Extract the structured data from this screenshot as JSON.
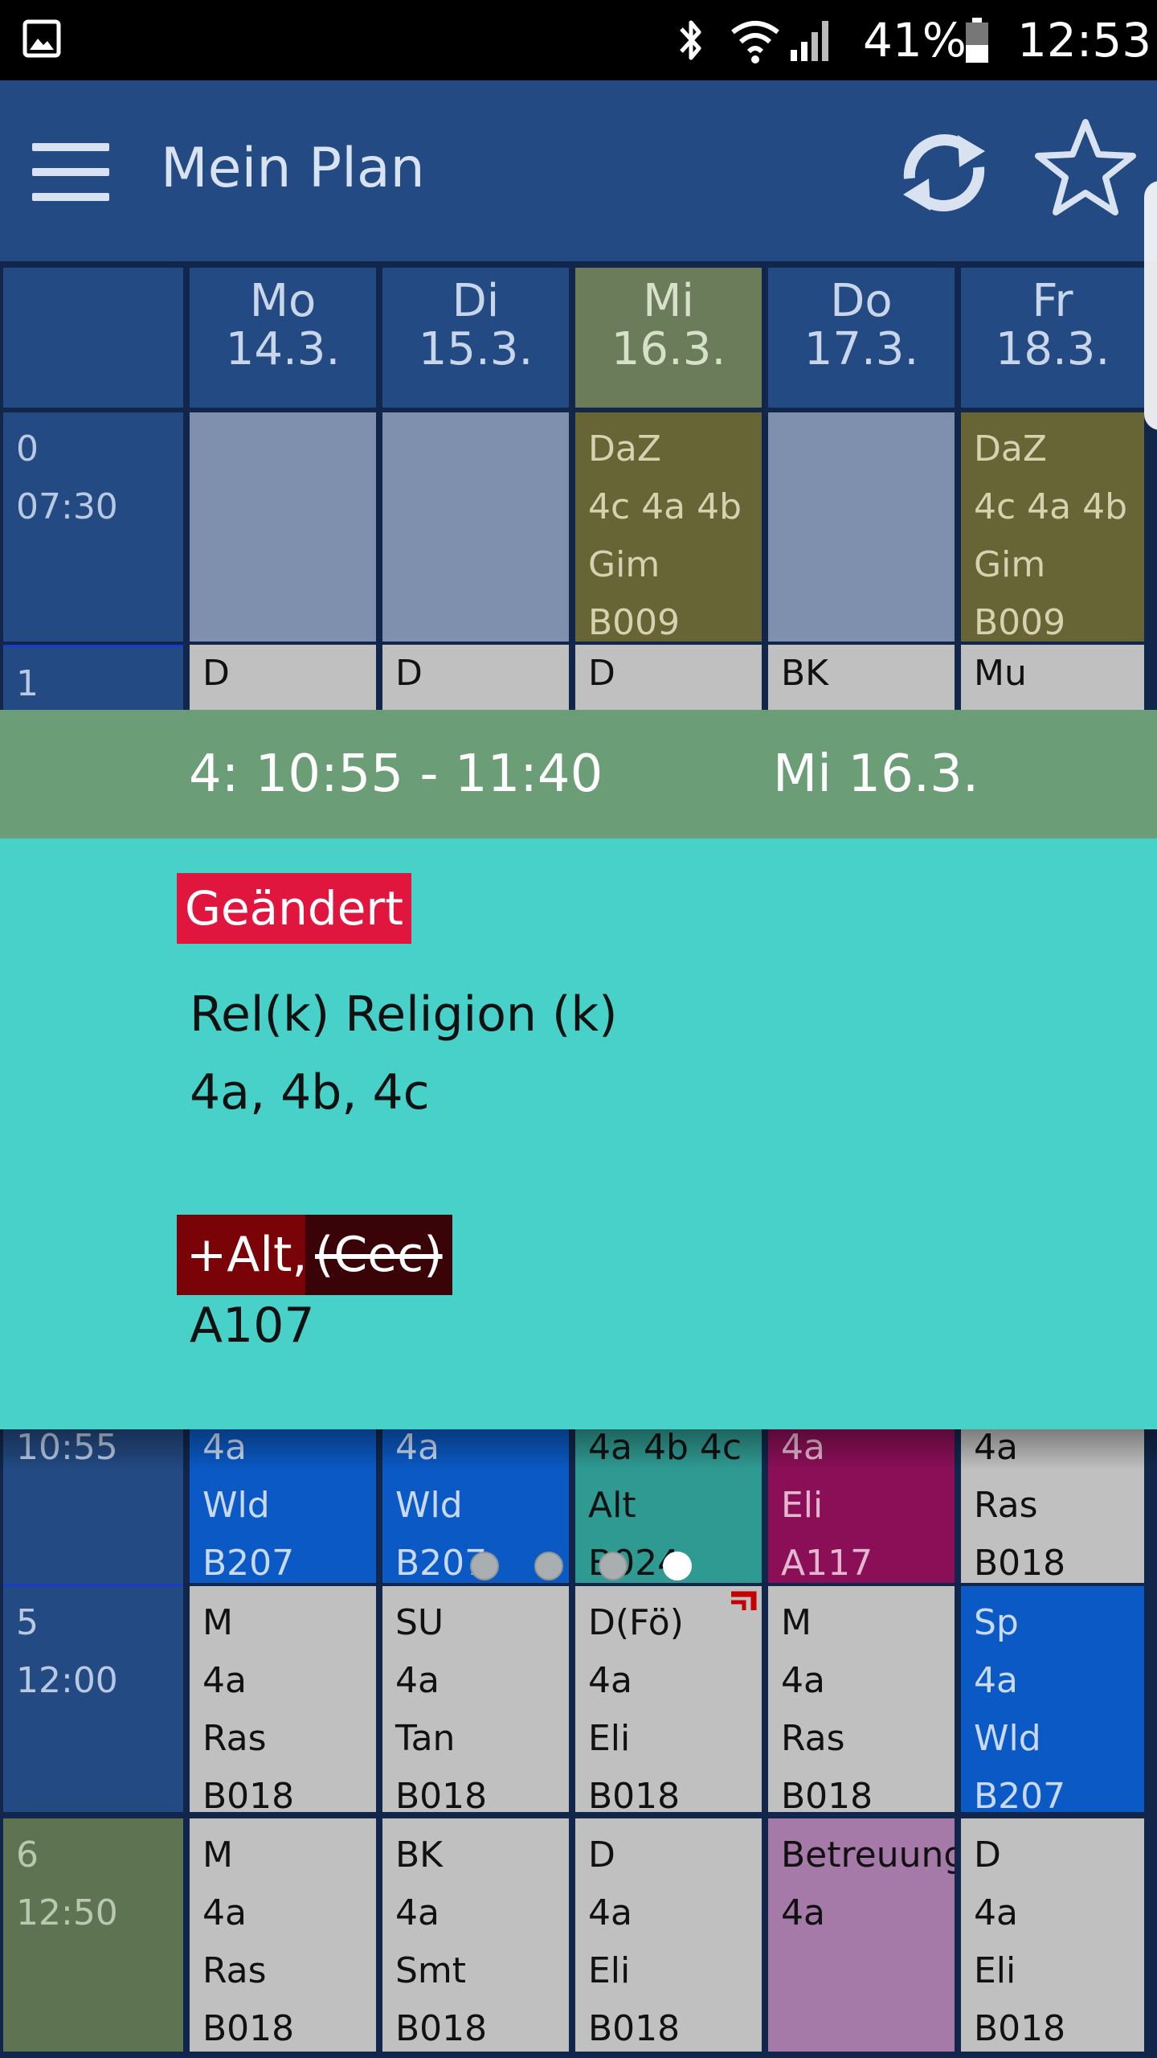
{
  "status_bar": {
    "battery": "41%",
    "time": "12:53",
    "icons": [
      "gallery-icon",
      "bluetooth-icon",
      "wifi-icon",
      "signal-icon",
      "battery-icon"
    ]
  },
  "app_bar": {
    "title": "Mein Plan",
    "icons": [
      "menu-icon",
      "refresh-icon",
      "star-icon"
    ]
  },
  "days": [
    {
      "name": "Mo",
      "date": "14.3."
    },
    {
      "name": "Di",
      "date": "15.3."
    },
    {
      "name": "Mi",
      "date": "16.3."
    },
    {
      "name": "Do",
      "date": "17.3."
    },
    {
      "name": "Fr",
      "date": "18.3."
    }
  ],
  "periods": {
    "p0": {
      "num": "0",
      "time": "07:30"
    },
    "p1": {
      "num": "1"
    },
    "p4": {
      "time": "10:55"
    },
    "p5": {
      "num": "5",
      "time": "12:00"
    },
    "p6": {
      "num": "6",
      "time": "12:50"
    }
  },
  "rows": {
    "r0": [
      {
        "lines": []
      },
      {
        "lines": []
      },
      {
        "lines": [
          "DaZ",
          "4c 4a 4b",
          "Gim",
          "B009"
        ]
      },
      {
        "lines": []
      },
      {
        "lines": [
          "DaZ",
          "4c 4a 4b",
          "Gim",
          "B009"
        ]
      }
    ],
    "r1": [
      {
        "lines": [
          "D"
        ]
      },
      {
        "lines": [
          "D"
        ]
      },
      {
        "lines": [
          "D"
        ]
      },
      {
        "lines": [
          "BK"
        ]
      },
      {
        "lines": [
          "Mu"
        ]
      }
    ],
    "r4": [
      {
        "lines": [
          "4a",
          "Wld",
          "B207"
        ]
      },
      {
        "lines": [
          "4a",
          "Wld",
          "B207"
        ]
      },
      {
        "lines": [
          "4a 4b 4c",
          "Alt",
          "B024"
        ]
      },
      {
        "lines": [
          "4a",
          "Eli",
          "A117"
        ]
      },
      {
        "lines": [
          "4a",
          "Ras",
          "B018"
        ]
      }
    ],
    "r5": [
      {
        "lines": [
          "M",
          "4a",
          "Ras",
          "B018"
        ]
      },
      {
        "lines": [
          "SU",
          "4a",
          "Tan",
          "B018"
        ]
      },
      {
        "lines": [
          "D(Fö)",
          "4a",
          "Eli",
          "B018"
        ]
      },
      {
        "lines": [
          "M",
          "4a",
          "Ras",
          "B018"
        ]
      },
      {
        "lines": [
          "Sp",
          "4a",
          "Wld",
          "B207"
        ]
      }
    ],
    "r6": [
      {
        "lines": [
          "M",
          "4a",
          "Ras",
          "B018"
        ]
      },
      {
        "lines": [
          "BK",
          "4a",
          "Smt",
          "B018"
        ]
      },
      {
        "lines": [
          "D",
          "4a",
          "Eli",
          "B018"
        ]
      },
      {
        "lines": [
          "Betreuung",
          "4a"
        ]
      },
      {
        "lines": [
          "D",
          "4a",
          "Eli",
          "B018"
        ]
      }
    ]
  },
  "detail": {
    "period_label": "4:  10:55 - 11:40",
    "day_label": "Mi   16.3.",
    "status_tag": "Geändert",
    "subject": "Rel(k)  Religion (k)",
    "classes": "4a,  4b,  4c",
    "teacher_added": "+Alt,",
    "teacher_removed": "(Cec)",
    "room": "A107",
    "pages": 4,
    "active_page": 4
  },
  "colors": {
    "appbar": "#234a82",
    "detail_header": "#6b9e76",
    "detail_body": "#48d1c9",
    "changed_tag": "#e0163f"
  }
}
